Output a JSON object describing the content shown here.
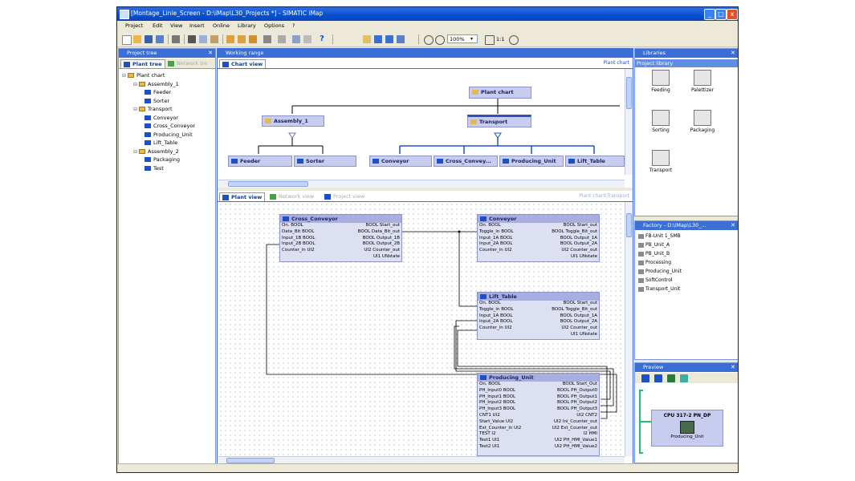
{
  "window": {
    "title": "[Montage_Linie_Screen - D:\\iMap\\L30_Projects *] - SIMATIC iMap",
    "minimize": "_",
    "maximize": "□",
    "close": "x"
  },
  "menu": [
    "Project",
    "Edit",
    "View",
    "Insert",
    "Online",
    "Library",
    "Options",
    "?"
  ],
  "toolbar": {
    "zoom": "100%",
    "ratio": "1:1",
    "help": "?"
  },
  "project_tree": {
    "title": "Project tree",
    "tabs": [
      "Plant tree",
      "Network tre"
    ],
    "items": [
      {
        "label": "Plant chart",
        "level": 0,
        "kind": "folder"
      },
      {
        "label": "Assembly_1",
        "level": 1,
        "kind": "folder"
      },
      {
        "label": "Feeder",
        "level": 2,
        "kind": "fb"
      },
      {
        "label": "Sorter",
        "level": 2,
        "kind": "fb"
      },
      {
        "label": "Transport",
        "level": 1,
        "kind": "folder"
      },
      {
        "label": "Conveyor",
        "level": 2,
        "kind": "fb"
      },
      {
        "label": "Cross_Conveyor",
        "level": 2,
        "kind": "fb"
      },
      {
        "label": "Producing_Unit",
        "level": 2,
        "kind": "fb"
      },
      {
        "label": "Lift_Table",
        "level": 2,
        "kind": "fb"
      },
      {
        "label": "Assembly_2",
        "level": 1,
        "kind": "folder"
      },
      {
        "label": "Packaging",
        "level": 2,
        "kind": "fb"
      },
      {
        "label": "Test",
        "level": 2,
        "kind": "fb"
      }
    ]
  },
  "working_range": {
    "title": "Working range",
    "chart_tab": "Chart view",
    "chart_path": "Plant chart",
    "chart_nodes": {
      "plant_chart": "Plant chart",
      "assembly_1": "Assembly_1",
      "transport": "Transport",
      "feeder": "Feeder",
      "sorter": "Sorter",
      "conveyor": "Conveyor",
      "cross_conveyor": "Cross_Convey...",
      "producing_unit": "Producing_Unit",
      "lift_table": "Lift_Table"
    },
    "view_tabs": [
      "Plant view",
      "Network view",
      "Project view"
    ],
    "view_path": "Plant chart\\Transport"
  },
  "function_blocks": [
    {
      "name": "Cross_Conveyor",
      "rows": [
        [
          "On. BOOL",
          "BOOL Start_out"
        ],
        [
          "Data_Bit BOOL",
          "BOOL Data_Bit_out"
        ],
        [
          "Input_1B BOOL",
          "BOOL Output_1B"
        ],
        [
          "Input_2B BOOL",
          "BOOL Output_2B"
        ],
        [
          "Counter_in UI2",
          "UI2 Counter_out"
        ],
        [
          "",
          "UI1 UNstate"
        ]
      ]
    },
    {
      "name": "Conveyor",
      "rows": [
        [
          "On. BOOL",
          "BOOL Start_out"
        ],
        [
          "Toggle_in BOOL",
          "BOOL Toggle_Bit_out"
        ],
        [
          "Input_1A BOOL",
          "BOOL Output_1A"
        ],
        [
          "Input_2A BOOL",
          "BOOL Output_2A"
        ],
        [
          "Counter_in UI2",
          "UI2 Counter_out"
        ],
        [
          "",
          "UI1 UNstate"
        ]
      ]
    },
    {
      "name": "Lift_Table",
      "rows": [
        [
          "On. BOOL",
          "BOOL Start_out"
        ],
        [
          "Toggle_in BOOL",
          "BOOL Toggle_Bit_out"
        ],
        [
          "Input_1A BOOL",
          "BOOL Output_1A"
        ],
        [
          "Input_2A BOOL",
          "BOOL Output_2A"
        ],
        [
          "Counter_in UI2",
          "UI2 Counter_out"
        ],
        [
          "",
          "UI1 UNstate"
        ]
      ]
    },
    {
      "name": "Producing_Unit",
      "rows": [
        [
          "On. BOOL",
          "BOOL Start_Out"
        ],
        [
          "PH_Input0 BOOL",
          "BOOL PH_Output0"
        ],
        [
          "PH_Input1 BOOL",
          "BOOL PH_Output1"
        ],
        [
          "PH_Input2 BOOL",
          "BOOL PH_Output2"
        ],
        [
          "PH_Input3 BOOL",
          "BOOL PH_Output3"
        ],
        [
          "CNT1 UI2",
          "UI2 CNT2"
        ],
        [
          "Start_Value UI2",
          "UI2 Ini_Counter_out"
        ],
        [
          "Ext_Counter_in UI2",
          "UI2 Ext_Counter_out"
        ],
        [
          "TEST I2",
          "I2 HMI"
        ],
        [
          "Test1 UI1",
          "UI2 PH_HMI_Value1"
        ],
        [
          "Test2 UI1",
          "UI2 PH_HMI_Value2"
        ]
      ]
    }
  ],
  "libraries": {
    "title": "Libraries",
    "section": "Project library",
    "items": [
      "Feeding",
      "Palettizer",
      "Sorting",
      "Packaging",
      "Transport"
    ]
  },
  "factory": {
    "title": "Factory - D:\\iMap\\L30_...",
    "items": [
      "FB-Unit 1_SMB",
      "PB_Unit_A",
      "PB_Unit_B",
      "Processing",
      "Producing_Unit",
      "SoftControl",
      "Transport_Unit"
    ]
  },
  "preview": {
    "title": "Preview",
    "device": "CPU 317-2 PN_DP",
    "device_item": "Producing_Unit"
  },
  "colors": {
    "accent": "#3b6fd6",
    "node_fill": "#c8cdf0",
    "fb_fill": "#dde0f3"
  }
}
